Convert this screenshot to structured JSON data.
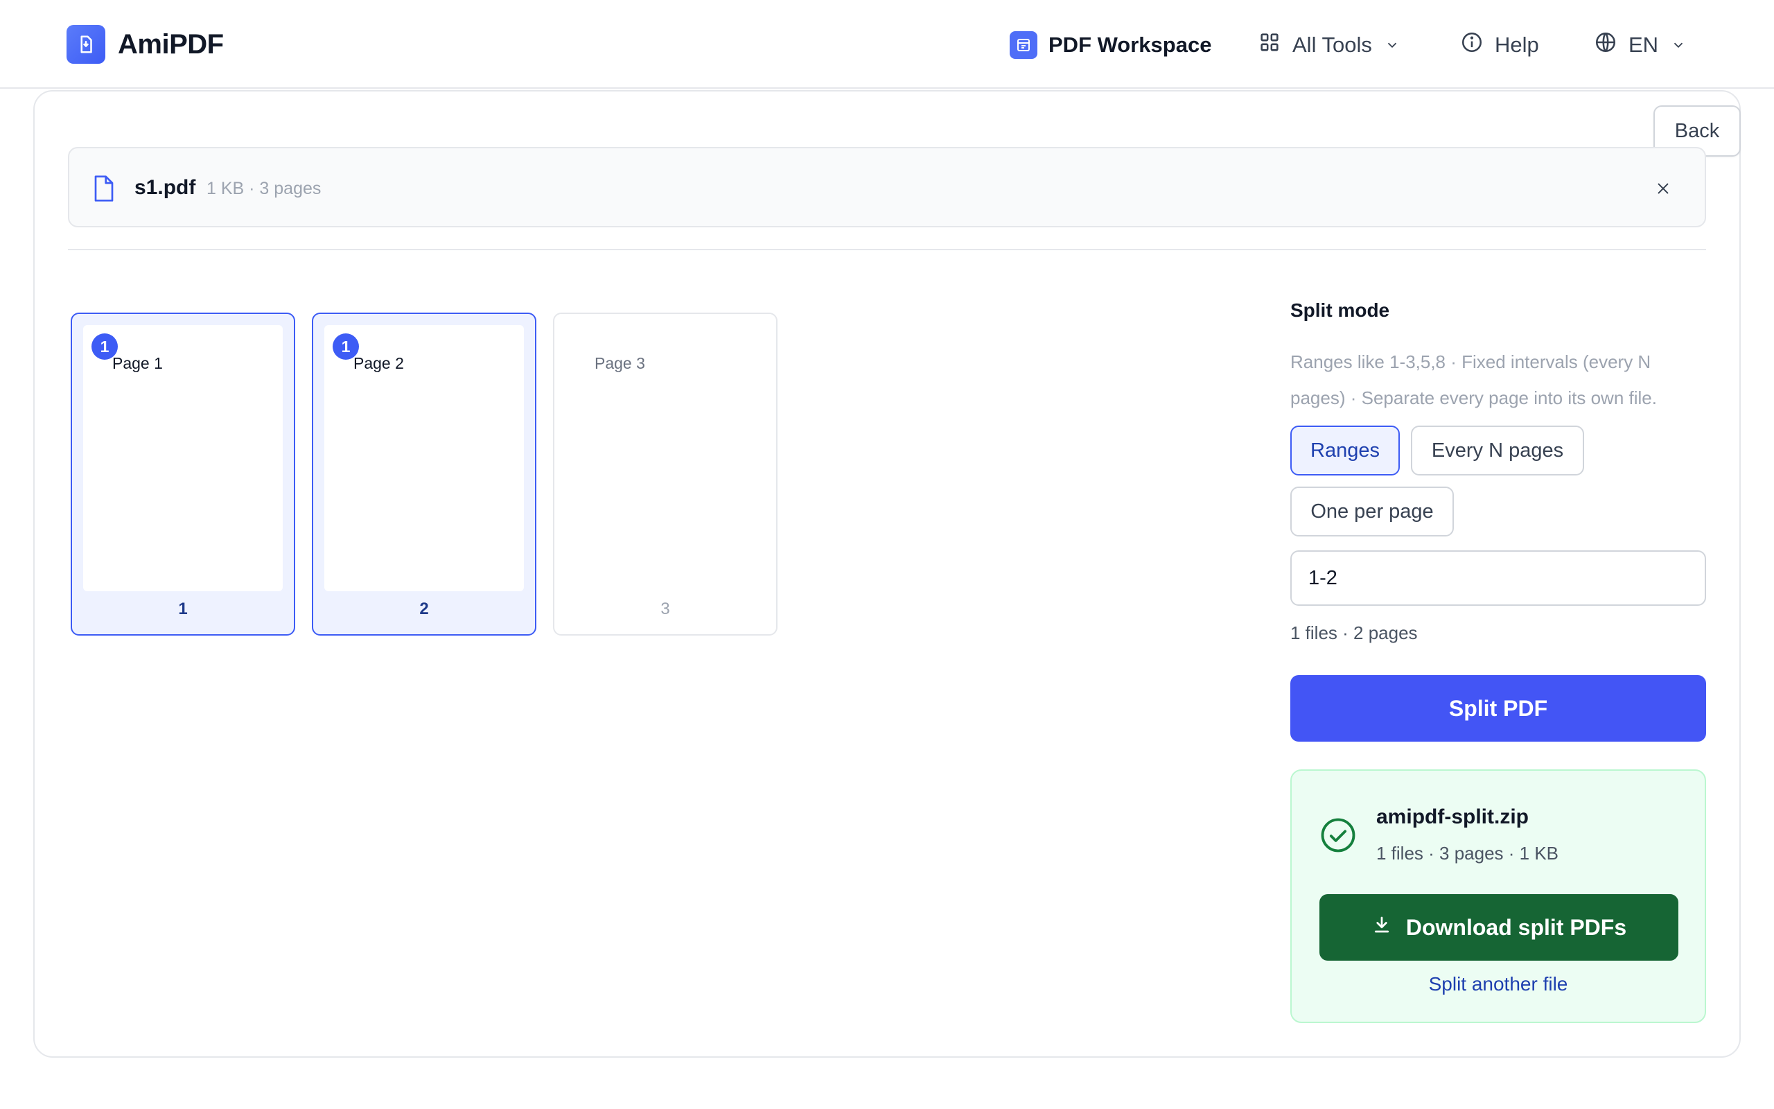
{
  "app": {
    "name": "AmiPDF"
  },
  "nav": {
    "workspace": "PDF Workspace",
    "all_tools": "All Tools",
    "help": "Help",
    "language": "EN"
  },
  "toolbar": {
    "back_label": "Back"
  },
  "file": {
    "name": "s1.pdf",
    "meta": "1 KB · 3 pages"
  },
  "thumbnails": [
    {
      "label": "Page 1",
      "number": "1",
      "badge": "1",
      "selected": true
    },
    {
      "label": "Page 2",
      "number": "2",
      "badge": "1",
      "selected": true
    },
    {
      "label": "Page 3",
      "number": "3",
      "selected": false
    }
  ],
  "split_mode": {
    "title": "Split mode",
    "description": "Ranges like 1-3,5,8 · Fixed intervals (every N pages) · Separate every page into its own file.",
    "modes": [
      "Ranges",
      "Every N pages",
      "One per page"
    ],
    "active_mode": "Ranges",
    "range_value": "1-2",
    "summary": "1 files · 2 pages",
    "split_label": "Split PDF"
  },
  "result": {
    "file_name": "amipdf-split.zip",
    "meta": "1 files · 3 pages · 1 KB",
    "download_label": "Download split PDFs",
    "another_label": "Split another file"
  },
  "colors": {
    "accent": "#4355f5",
    "selected_bg": "#eef2ff",
    "success": "#166534",
    "success_bg": "#ecfdf3"
  }
}
